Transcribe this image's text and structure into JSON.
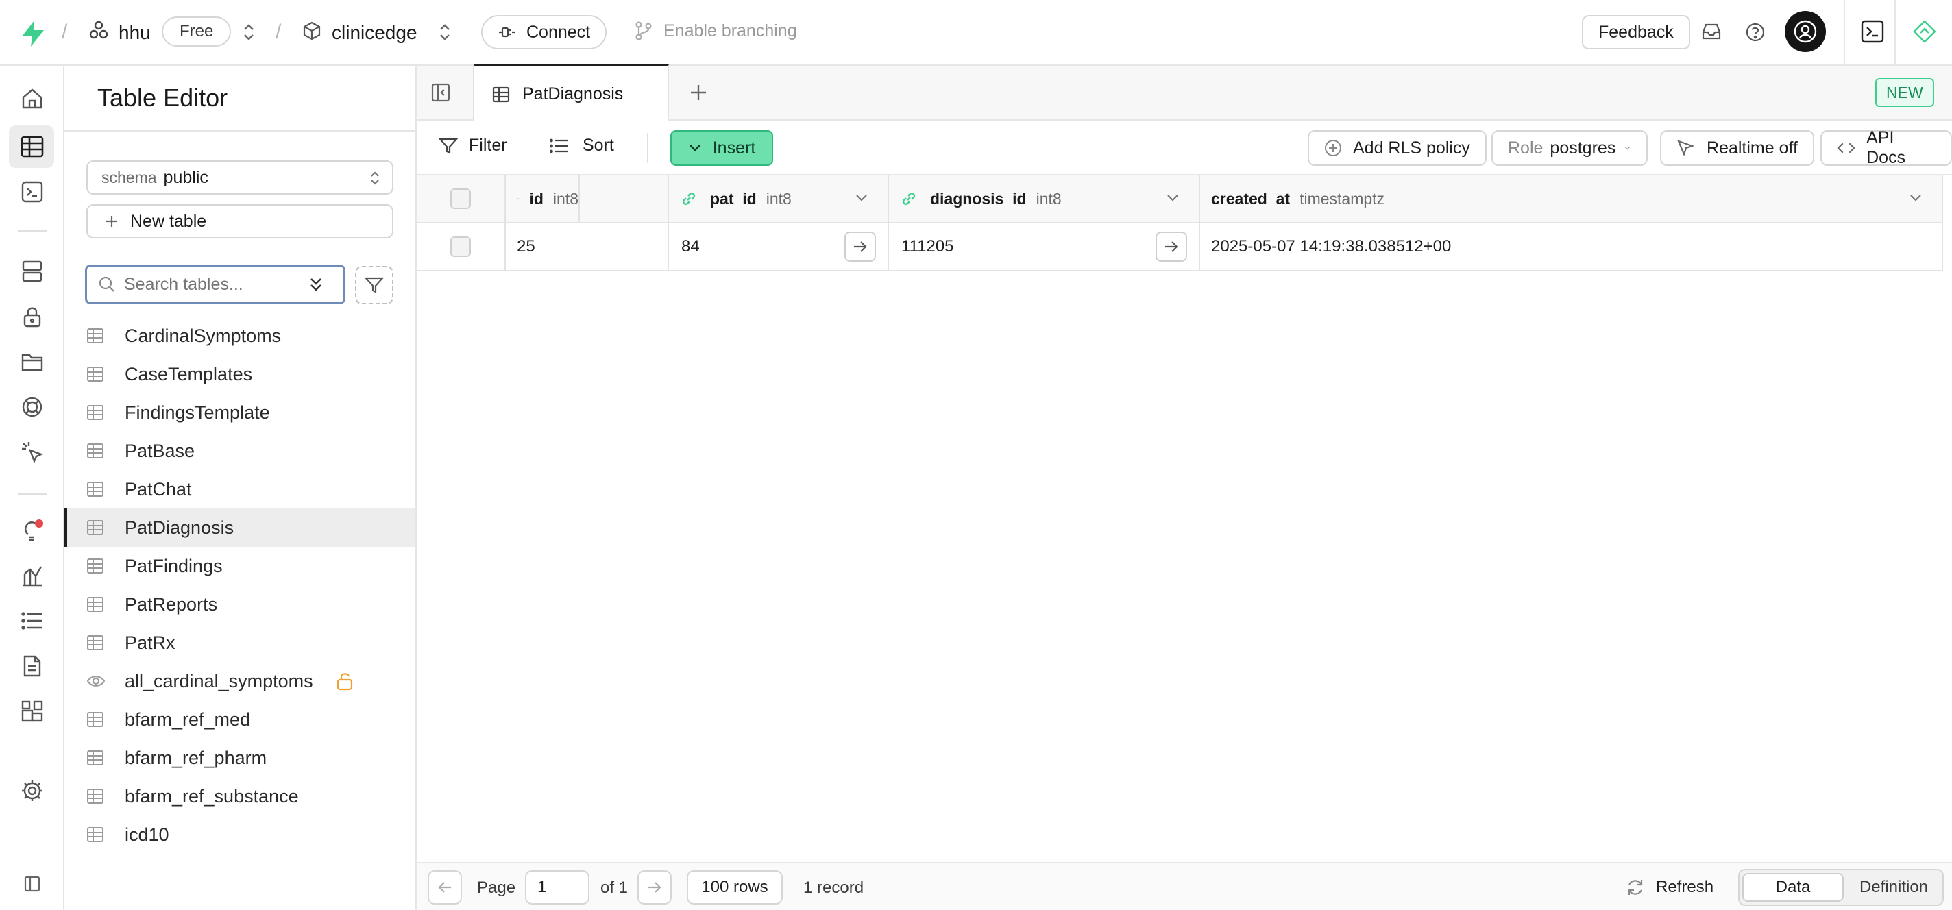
{
  "topbar": {
    "org": "hhu",
    "plan": "Free",
    "project": "clinicedge",
    "connect": "Connect",
    "branching": "Enable branching",
    "feedback": "Feedback"
  },
  "sidebar": {
    "title": "Table Editor",
    "schema_label": "schema",
    "schema_value": "public",
    "new_table": "New table",
    "search_placeholder": "Search tables...",
    "tables": [
      {
        "name": "CardinalSymptoms",
        "kind": "table"
      },
      {
        "name": "CaseTemplates",
        "kind": "table"
      },
      {
        "name": "FindingsTemplate",
        "kind": "table"
      },
      {
        "name": "PatBase",
        "kind": "table"
      },
      {
        "name": "PatChat",
        "kind": "table"
      },
      {
        "name": "PatDiagnosis",
        "kind": "table",
        "active": true
      },
      {
        "name": "PatFindings",
        "kind": "table"
      },
      {
        "name": "PatReports",
        "kind": "table"
      },
      {
        "name": "PatRx",
        "kind": "table"
      },
      {
        "name": "all_cardinal_symptoms",
        "kind": "view",
        "unlocked": true
      },
      {
        "name": "bfarm_ref_med",
        "kind": "table"
      },
      {
        "name": "bfarm_ref_pharm",
        "kind": "table"
      },
      {
        "name": "bfarm_ref_substance",
        "kind": "table"
      },
      {
        "name": "icd10",
        "kind": "table"
      }
    ]
  },
  "tabs": {
    "active": "PatDiagnosis",
    "new_badge": "NEW"
  },
  "toolbar": {
    "filter": "Filter",
    "sort": "Sort",
    "insert": "Insert",
    "add_rls": "Add RLS policy",
    "role_label": "Role",
    "role_value": "postgres",
    "realtime": "Realtime off",
    "api_docs": "API Docs"
  },
  "grid": {
    "columns": [
      {
        "name": "id",
        "type": "int8",
        "icon": "key-icon"
      },
      {
        "name": "pat_id",
        "type": "int8",
        "icon": "link-icon"
      },
      {
        "name": "diagnosis_id",
        "type": "int8",
        "icon": "link-icon"
      },
      {
        "name": "created_at",
        "type": "timestamptz",
        "icon": ""
      }
    ],
    "rows": [
      {
        "id": "25",
        "pat_id": "84",
        "diagnosis_id": "111205",
        "created_at": "2025-05-07 14:19:38.038512+00"
      }
    ]
  },
  "footer": {
    "page_label": "Page",
    "page_value": "1",
    "of": "of 1",
    "rows": "100 rows",
    "records": "1 record",
    "refresh": "Refresh",
    "data": "Data",
    "definition": "Definition"
  },
  "colors": {
    "brand": "#3ecf8e",
    "insert_bg": "#6ee0ad",
    "insert_border": "#2fb879"
  }
}
